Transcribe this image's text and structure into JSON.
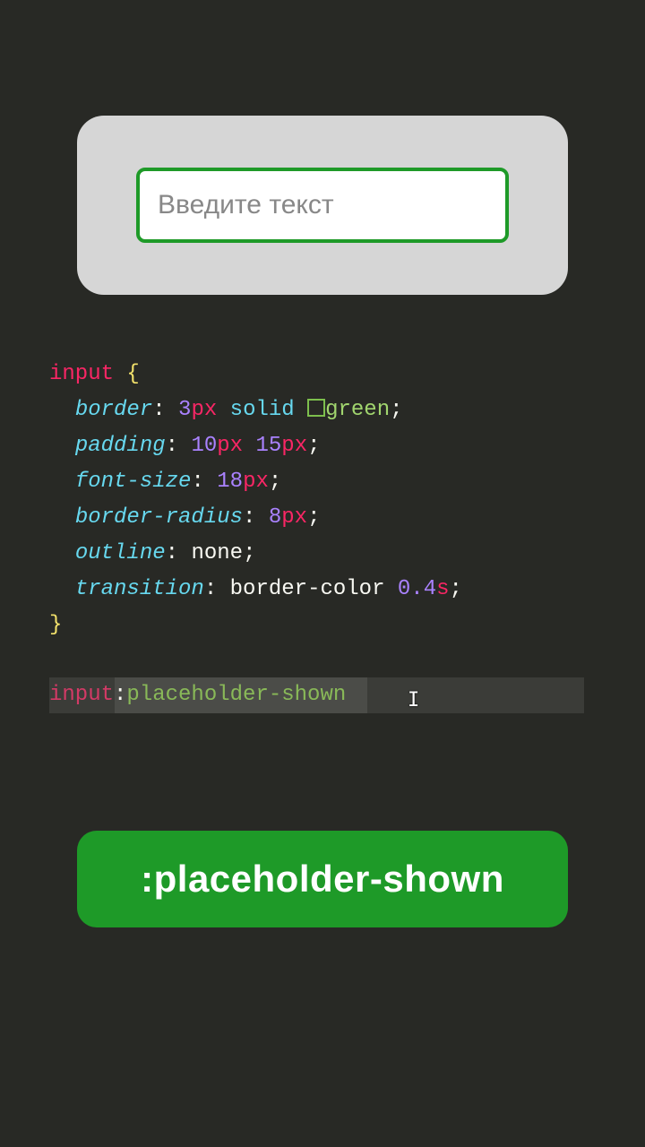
{
  "demo": {
    "input_placeholder": "Введите текст"
  },
  "code": {
    "selector": "input",
    "open_brace": " {",
    "lines": [
      {
        "prop": "border",
        "value_parts": [
          {
            "num": "3",
            "unit": "px"
          },
          {
            "txt": " "
          },
          {
            "kw": "solid"
          },
          {
            "txt": " "
          },
          {
            "swatch": true
          },
          {
            "color": "green"
          }
        ]
      },
      {
        "prop": "padding",
        "value_parts": [
          {
            "num": "10",
            "unit": "px"
          },
          {
            "txt": " "
          },
          {
            "num": "15",
            "unit": "px"
          }
        ]
      },
      {
        "prop": "font-size",
        "value_parts": [
          {
            "num": "18",
            "unit": "px"
          }
        ]
      },
      {
        "prop": "border-radius",
        "value_parts": [
          {
            "num": "8",
            "unit": "px"
          }
        ]
      },
      {
        "prop": "outline",
        "value_parts": [
          {
            "val": "none"
          }
        ]
      },
      {
        "prop": "transition",
        "value_parts": [
          {
            "val": "border-color "
          },
          {
            "num": "0.4",
            "unit": "s"
          }
        ]
      }
    ],
    "close_brace": "}",
    "typing": {
      "selector": "input",
      "colon": ":",
      "pseudo": "placeholder-shown"
    }
  },
  "badge": {
    "label": ":placeholder-shown"
  }
}
